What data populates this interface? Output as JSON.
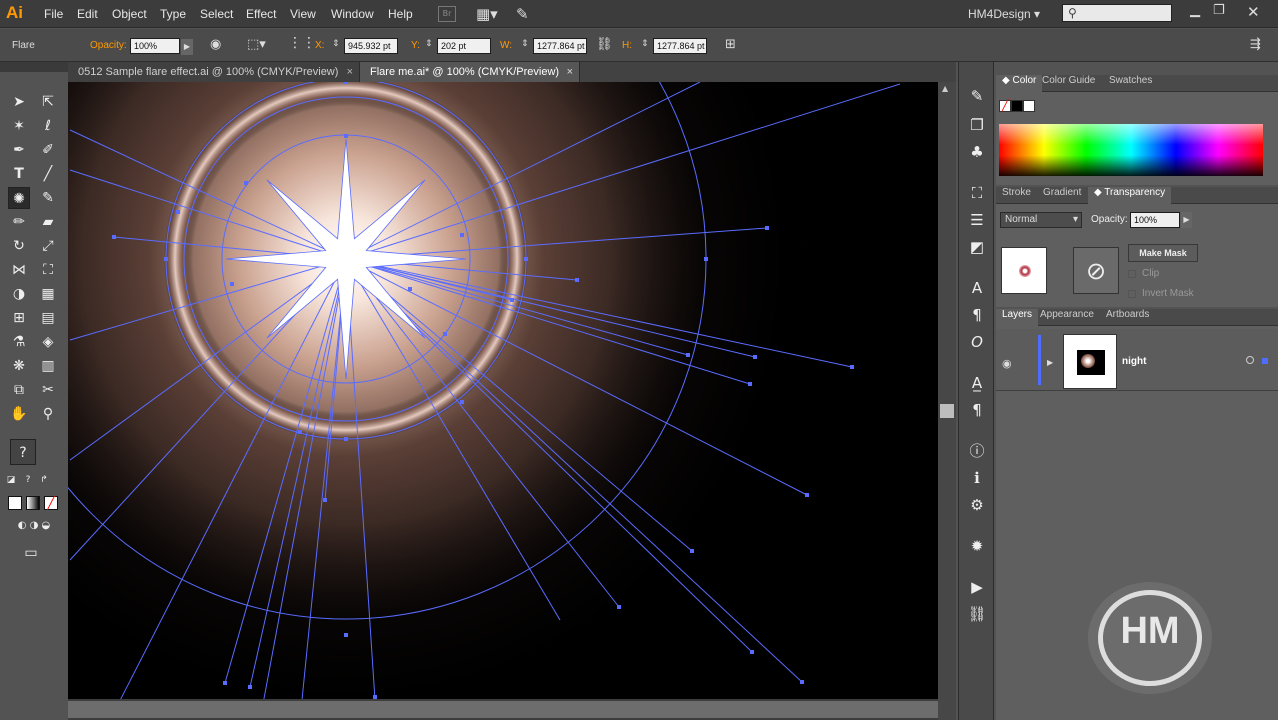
{
  "menubar": {
    "logo": "Ai",
    "items": [
      "File",
      "Edit",
      "Object",
      "Type",
      "Select",
      "Effect",
      "View",
      "Window",
      "Help"
    ],
    "workspace": "HM4Design",
    "search_placeholder": ""
  },
  "control_bar": {
    "selection_label": "Flare",
    "opacity_label": "Opacity:",
    "opacity_value": "100%",
    "x_label": "X:",
    "x_value": "945.932 pt",
    "y_label": "Y:",
    "y_value": "202 pt",
    "w_label": "W:",
    "w_value": "1277.864 pt",
    "h_label": "H:",
    "h_value": "1277.864 pt"
  },
  "document_tabs": [
    {
      "label": "0512 Sample flare effect.ai @ 100% (CMYK/Preview)",
      "close": "×"
    },
    {
      "label": "Flare me.ai* @ 100% (CMYK/Preview)",
      "close": "×"
    }
  ],
  "color_panel": {
    "tabs": [
      "Color",
      "Color Guide",
      "Swatches"
    ]
  },
  "transparency_panel": {
    "tabs": [
      "Stroke",
      "Gradient",
      "Transparency"
    ],
    "blend_mode": "Normal",
    "opacity_label": "Opacity:",
    "opacity_value": "100%",
    "make_mask": "Make Mask",
    "clip": "Clip",
    "invert_mask": "Invert Mask"
  },
  "layers_panel": {
    "tabs": [
      "Layers",
      "Appearance",
      "Artboards"
    ],
    "layer_name": "night"
  },
  "watermark": "HM",
  "colors": {
    "selection_blue": "#5a6cff",
    "app_bg": "#535353",
    "accent_orange": "#ff9a00"
  }
}
